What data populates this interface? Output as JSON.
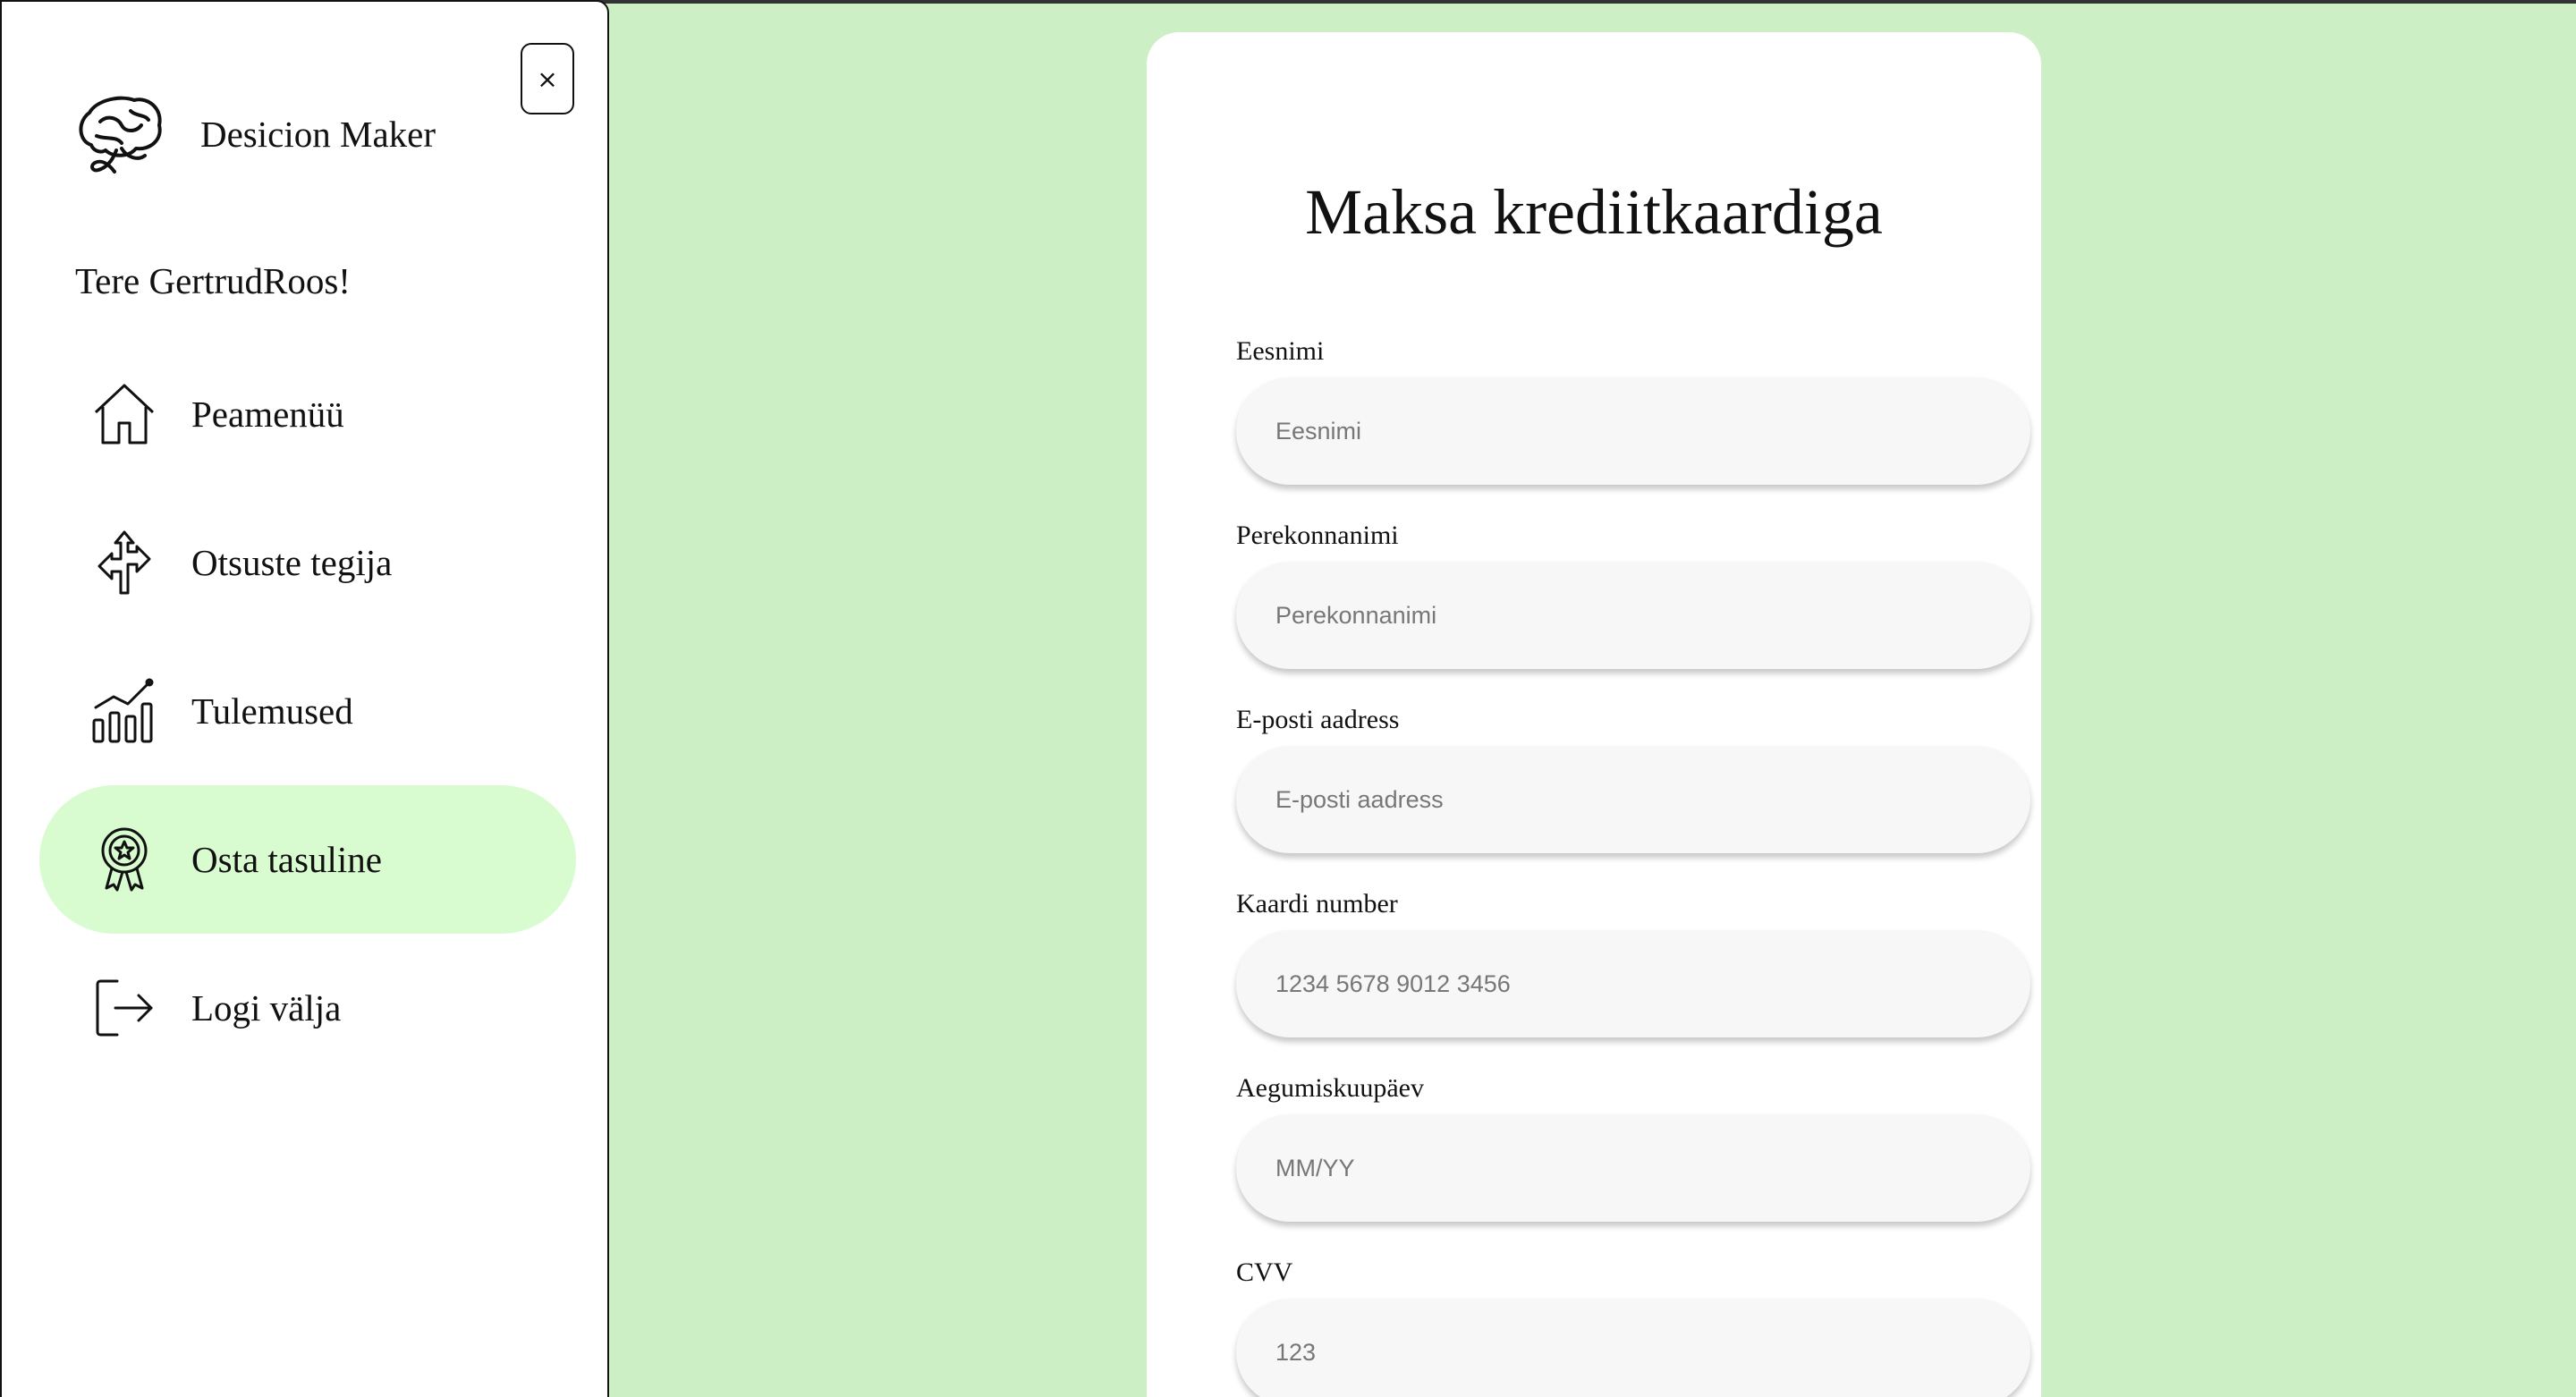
{
  "sidebar": {
    "close_label": "×",
    "brand": {
      "name": "Desicion Maker",
      "logo_icon": "brain-icon"
    },
    "greeting": "Tere GertrudRoos!",
    "items": [
      {
        "label": "Peamenüü",
        "icon": "home-icon",
        "active": false
      },
      {
        "label": "Otsuste tegija",
        "icon": "directions-icon",
        "active": false
      },
      {
        "label": "Tulemused",
        "icon": "bar-chart-icon",
        "active": false
      },
      {
        "label": "Osta tasuline",
        "icon": "award-icon",
        "active": true
      },
      {
        "label": "Logi välja",
        "icon": "logout-icon",
        "active": false
      }
    ]
  },
  "payment": {
    "title": "Maksa krediitkaardiga",
    "fields": [
      {
        "label": "Eesnimi",
        "placeholder": "Eesnimi",
        "value": ""
      },
      {
        "label": "Perekonnanimi",
        "placeholder": "Perekonnanimi",
        "value": ""
      },
      {
        "label": "E-posti aadress",
        "placeholder": "E-posti aadress",
        "value": ""
      },
      {
        "label": "Kaardi number",
        "placeholder": "1234 5678 9012 3456",
        "value": ""
      },
      {
        "label": "Aegumiskuupäev",
        "placeholder": "MM/YY",
        "value": ""
      },
      {
        "label": "CVV",
        "placeholder": "123",
        "value": ""
      }
    ]
  },
  "colors": {
    "background": "#cdefc5",
    "active_nav": "#d8fcd0",
    "input_bg": "#f7f7f7"
  }
}
